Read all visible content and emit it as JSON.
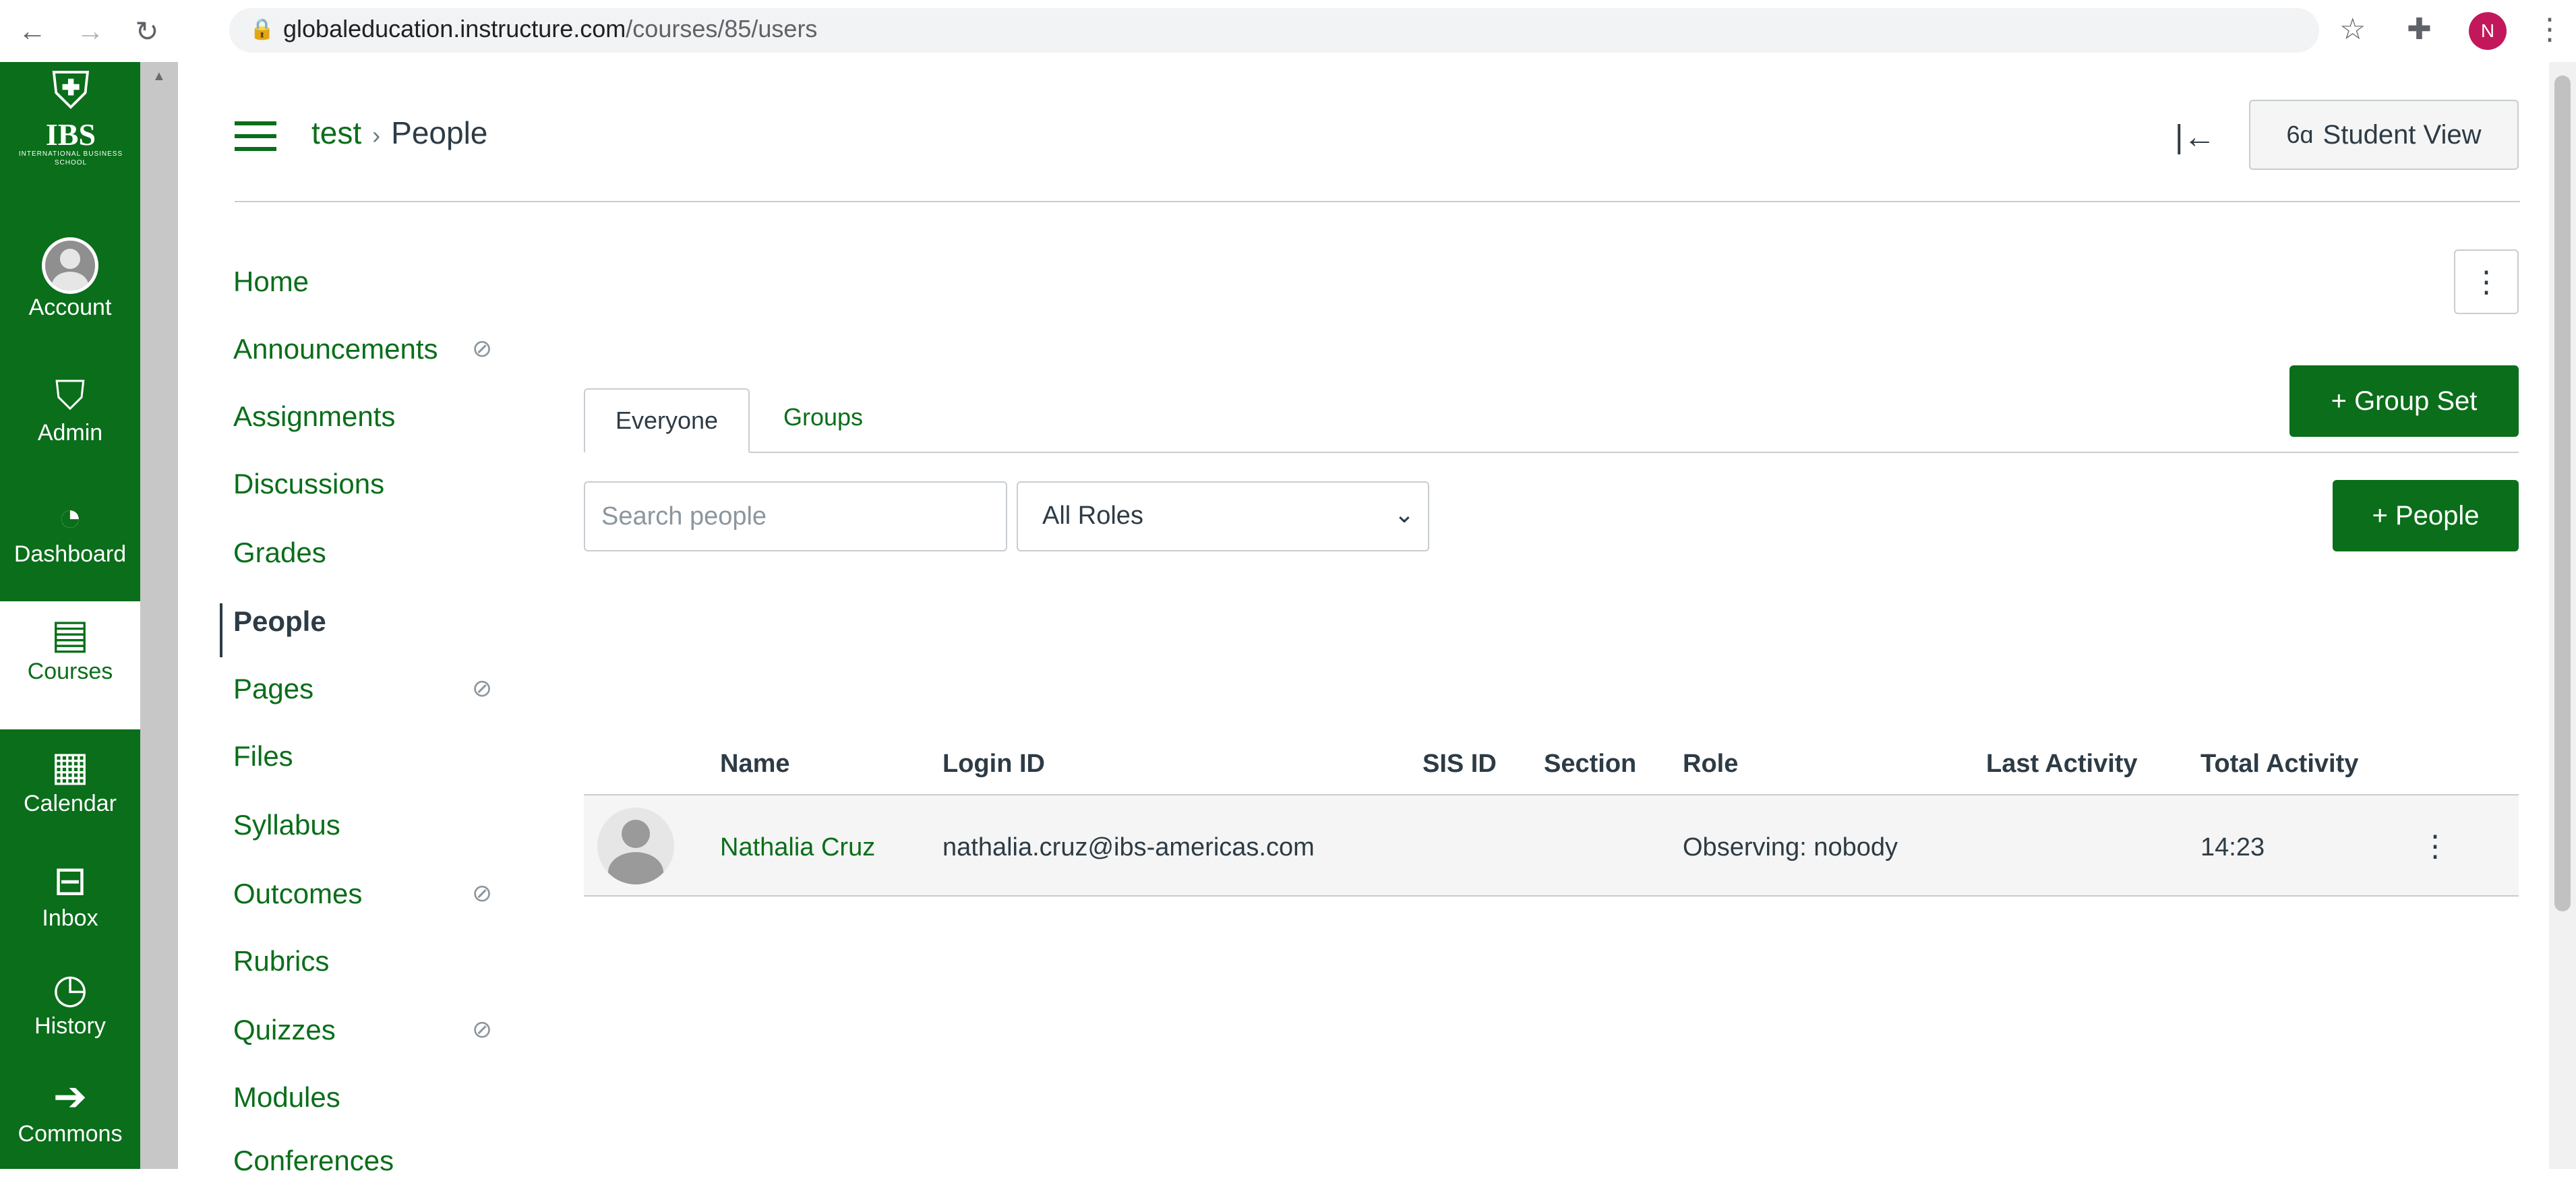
{
  "browser": {
    "url_host": "globaleducation.instructure.com",
    "url_path": "/courses/85/users",
    "profile_initial": "N"
  },
  "global_nav": {
    "logo": {
      "text": "IBS",
      "subtitle": "INTERNATIONAL BUSINESS SCHOOL"
    },
    "items": [
      {
        "label": "Account",
        "icon": "account-avatar-icon"
      },
      {
        "label": "Admin",
        "icon": "shield-icon"
      },
      {
        "label": "Dashboard",
        "icon": "speedometer-icon"
      },
      {
        "label": "Courses",
        "icon": "book-icon",
        "active": true
      },
      {
        "label": "Calendar",
        "icon": "calendar-icon"
      },
      {
        "label": "Inbox",
        "icon": "inbox-icon"
      },
      {
        "label": "History",
        "icon": "clock-icon"
      },
      {
        "label": "Commons",
        "icon": "commons-arrow-icon"
      }
    ]
  },
  "header": {
    "breadcrumb": {
      "course": "test",
      "current": "People"
    },
    "student_view_label": "Student View"
  },
  "course_nav": {
    "items": [
      {
        "label": "Home"
      },
      {
        "label": "Announcements",
        "hidden": true
      },
      {
        "label": "Assignments"
      },
      {
        "label": "Discussions"
      },
      {
        "label": "Grades"
      },
      {
        "label": "People",
        "active": true
      },
      {
        "label": "Pages",
        "hidden": true
      },
      {
        "label": "Files"
      },
      {
        "label": "Syllabus"
      },
      {
        "label": "Outcomes",
        "hidden": true
      },
      {
        "label": "Rubrics"
      },
      {
        "label": "Quizzes",
        "hidden": true
      },
      {
        "label": "Modules"
      },
      {
        "label": "Conferences"
      }
    ]
  },
  "people": {
    "group_set_button": "+ Group Set",
    "add_people_button": "+ People",
    "tabs": [
      "Everyone",
      "Groups"
    ],
    "search_placeholder": "Search people",
    "role_filter": "All Roles",
    "columns": [
      "Name",
      "Login ID",
      "SIS ID",
      "Section",
      "Role",
      "Last Activity",
      "Total Activity"
    ],
    "rows": [
      {
        "name": "Nathalia Cruz",
        "login_id": "nathalia.cruz@ibs-americas.com",
        "sis_id": "",
        "section": "",
        "role": "Observing: nobody",
        "last_activity": "",
        "total_activity": "14:23"
      }
    ]
  },
  "colors": {
    "brand": "#0a6e1a",
    "text": "#2d3b45",
    "border": "#c7cdd1"
  }
}
